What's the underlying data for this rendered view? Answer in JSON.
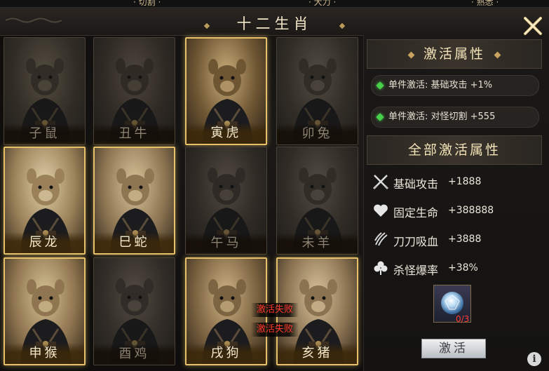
{
  "top_strip": [
    "· 切割 ·",
    "· 大力 ·",
    "· 熟悉 ·"
  ],
  "title": "十二生肖",
  "zodiac": [
    {
      "name": "子鼠",
      "active": false
    },
    {
      "name": "丑牛",
      "active": false
    },
    {
      "name": "寅虎",
      "active": true
    },
    {
      "name": "卯兔",
      "active": false
    },
    {
      "name": "辰龙",
      "active": true
    },
    {
      "name": "巳蛇",
      "active": true
    },
    {
      "name": "午马",
      "active": false
    },
    {
      "name": "未羊",
      "active": false
    },
    {
      "name": "申猴",
      "active": true
    },
    {
      "name": "酉鸡",
      "active": false
    },
    {
      "name": "戌狗",
      "active": true
    },
    {
      "name": "亥猪",
      "active": true
    }
  ],
  "fail_messages": [
    "激活失败",
    "激活失败"
  ],
  "activate_attr": {
    "header": "激活属性",
    "items": [
      {
        "text": "单件激活: 基础攻击 +1%"
      },
      {
        "text": "单件激活: 对怪切割 +555"
      }
    ]
  },
  "all_attr": {
    "header": "全部激活属性",
    "items": [
      {
        "icon": "crossed-swords-icon",
        "label": "基础攻击",
        "value": "+1888"
      },
      {
        "icon": "heart-icon",
        "label": "固定生命",
        "value": "+388888"
      },
      {
        "icon": "claw-slash-icon",
        "label": "刀刀吸血",
        "value": "+3888"
      },
      {
        "icon": "clover-icon",
        "label": "杀怪爆率",
        "value": "+38%"
      }
    ]
  },
  "item_count": "0/3",
  "activate_button": "激活",
  "info_button": "i",
  "colors": {
    "accent": "#e7c16a",
    "fail": "#ff3a2e",
    "green": "#48d14b"
  }
}
